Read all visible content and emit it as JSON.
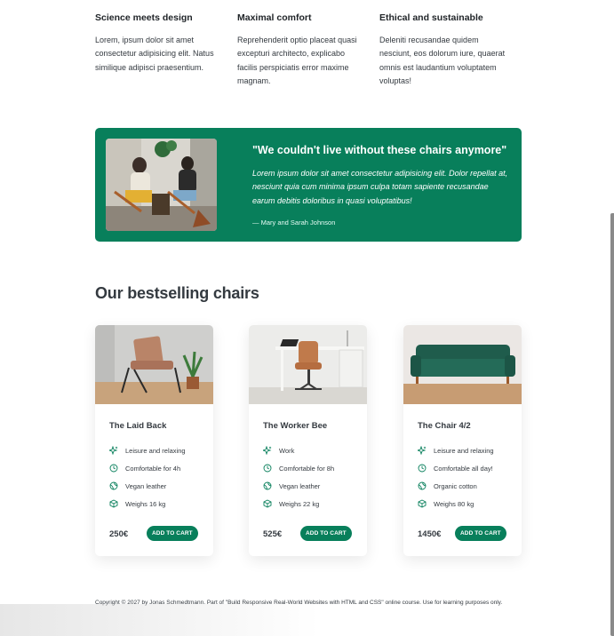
{
  "features": [
    {
      "title": "Science meets design",
      "text": "Lorem, ipsum dolor sit amet consectetur adipisicing elit. Natus similique adipisci praesentium."
    },
    {
      "title": "Maximal comfort",
      "text": "Reprehenderit optio placeat quasi excepturi architecto, explicabo facilis perspiciatis error maxime magnam."
    },
    {
      "title": "Ethical and sustainable",
      "text": "Deleniti recusandae quidem nesciunt, eos dolorum iure, quaerat omnis est laudantium voluptatem voluptas!"
    }
  ],
  "testimonial": {
    "title": "\"We couldn't live without these chairs anymore\"",
    "text": "Lorem ipsum dolor sit amet consectetur adipisicing elit. Dolor repellat at, nesciunt quia cum minima ipsum culpa totam sapiente recusandae earum debitis doloribus in quasi voluptatibus!",
    "author": "— Mary and Sarah Johnson"
  },
  "section_title": "Our bestselling chairs",
  "products": [
    {
      "name": "The Laid Back",
      "attributes": [
        "Leisure and relaxing",
        "Comfortable for 4h",
        "Vegan leather",
        "Weighs 16 kg"
      ],
      "price": "250€",
      "button": "ADD TO CART"
    },
    {
      "name": "The Worker Bee",
      "attributes": [
        "Work",
        "Comfortable for 8h",
        "Vegan leather",
        "Weighs 22 kg"
      ],
      "price": "525€",
      "button": "ADD TO CART"
    },
    {
      "name": "The Chair 4/2",
      "attributes": [
        "Leisure and relaxing",
        "Comfortable all day!",
        "Organic cotton",
        "Weighs 80 kg"
      ],
      "price": "1450€",
      "button": "ADD TO CART"
    }
  ],
  "attribute_icons": [
    "sparkles-icon",
    "clock-icon",
    "leaf-globe-icon",
    "cube-icon"
  ],
  "footer": "Copyright © 2027 by Jonas Schmedtmann. Part of \"Build Responsive Real-World Websites with HTML and CSS\" online course. Use for learning purposes only.",
  "colors": {
    "accent": "#087f5b",
    "text": "#343a40"
  }
}
